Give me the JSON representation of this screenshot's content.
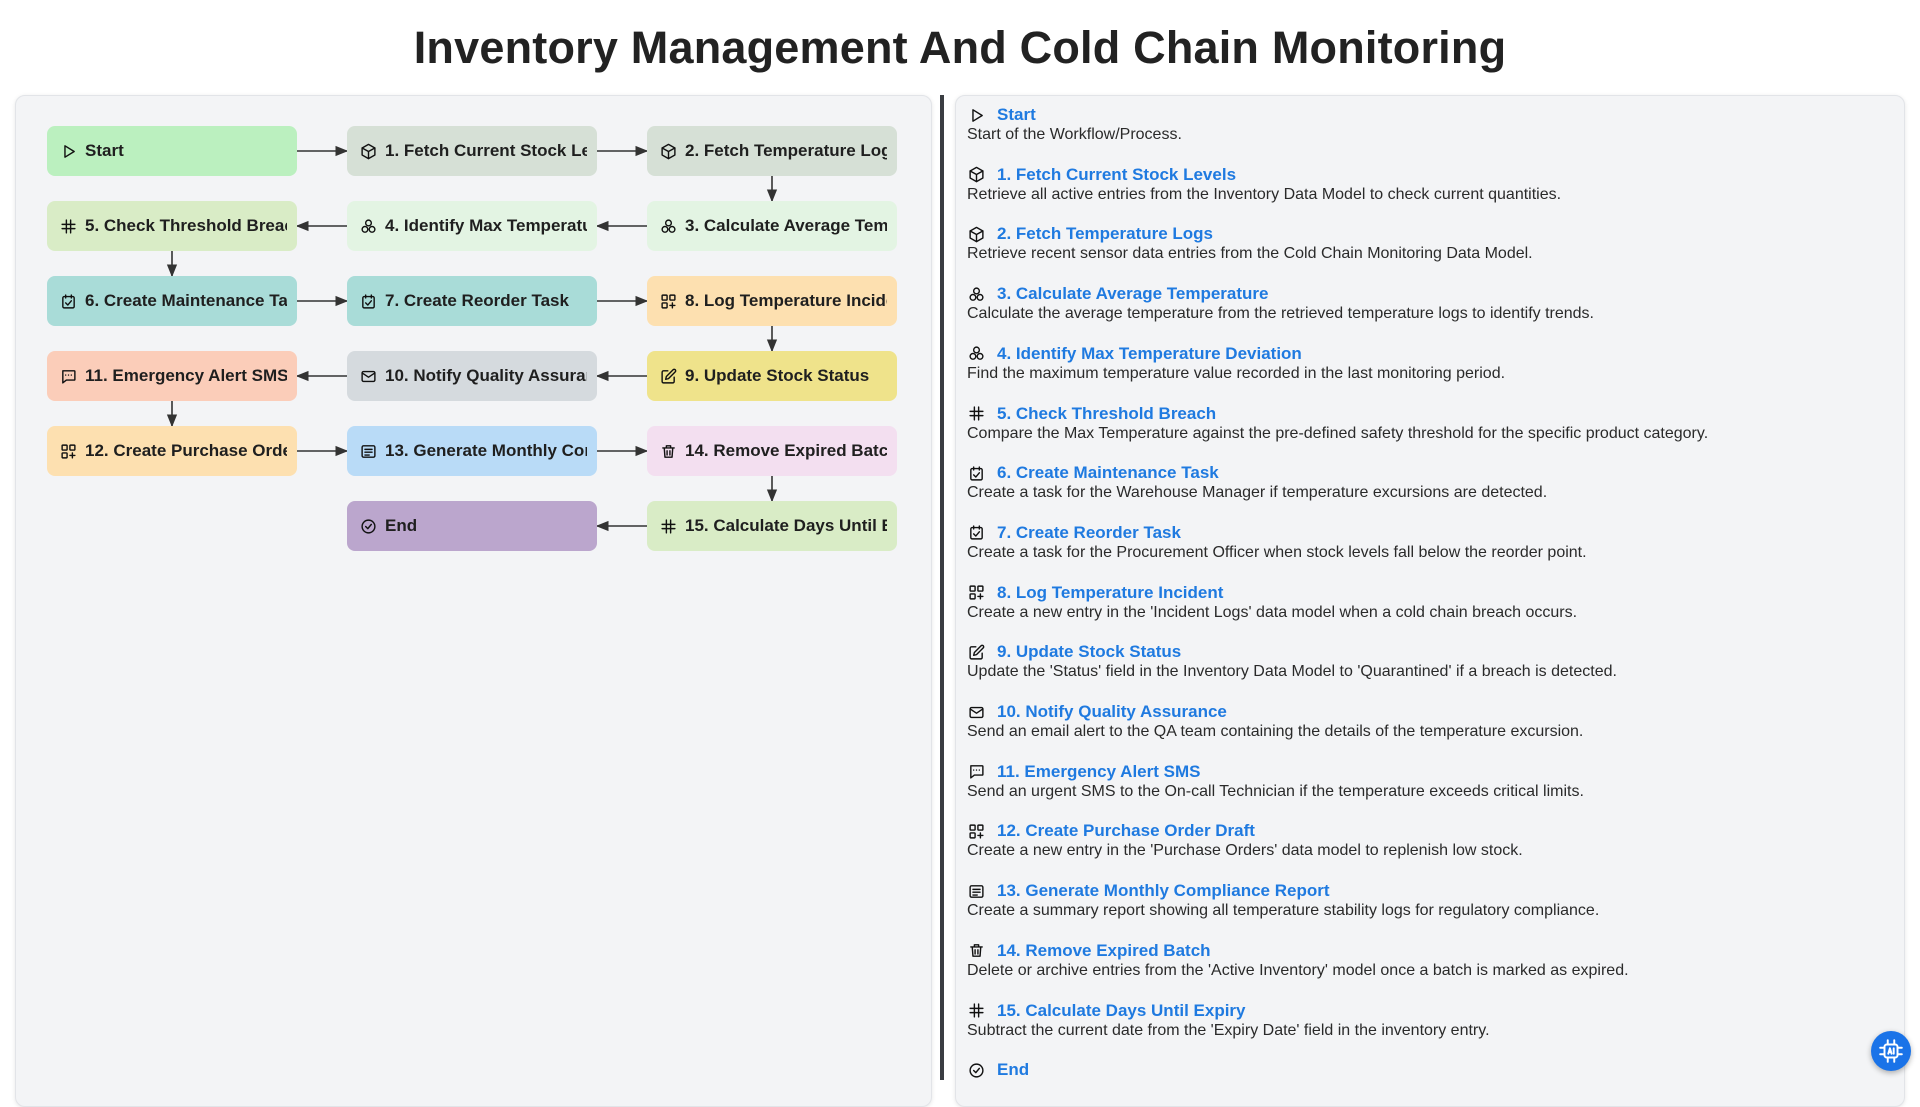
{
  "page": {
    "title": "Inventory Management And Cold Chain Monitoring"
  },
  "colors": {
    "green": "#bbf0bf",
    "sage": "#d6e0d6",
    "mint": "#e3f4e3",
    "lime": "#d9ecc6",
    "teal": "#a9dcd8",
    "peach": "#fde0b0",
    "yellow": "#efe38b",
    "gray": "#d5dade",
    "salmon": "#fbcdb9",
    "blue": "#b9dbf7",
    "pink": "#f3dff0",
    "purple": "#bba6cd",
    "link": "#1f7ae0",
    "fab": "#1a73e8"
  },
  "flow": {
    "nodes": [
      {
        "id": "start",
        "label": "Start",
        "icon": "play-icon",
        "color": "green"
      },
      {
        "id": "s1",
        "label": "1. Fetch Current Stock Levels",
        "icon": "cube-icon",
        "color": "sage"
      },
      {
        "id": "s2",
        "label": "2. Fetch Temperature Logs",
        "icon": "cube-icon",
        "color": "sage"
      },
      {
        "id": "s3",
        "label": "3. Calculate Average Temperature",
        "icon": "function-icon",
        "color": "mint"
      },
      {
        "id": "s4",
        "label": "4. Identify Max Temperature Deviation",
        "icon": "function-icon",
        "color": "mint"
      },
      {
        "id": "s5",
        "label": "5. Check Threshold Breach",
        "icon": "hash-icon",
        "color": "lime"
      },
      {
        "id": "s6",
        "label": "6. Create Maintenance Task",
        "icon": "task-icon",
        "color": "teal"
      },
      {
        "id": "s7",
        "label": "7. Create Reorder Task",
        "icon": "task-icon",
        "color": "teal"
      },
      {
        "id": "s8",
        "label": "8. Log Temperature Incident",
        "icon": "grid-plus-icon",
        "color": "peach"
      },
      {
        "id": "s9",
        "label": "9. Update Stock Status",
        "icon": "edit-icon",
        "color": "yellow"
      },
      {
        "id": "s10",
        "label": "10. Notify Quality Assurance",
        "icon": "mail-icon",
        "color": "gray"
      },
      {
        "id": "s11",
        "label": "11. Emergency Alert SMS",
        "icon": "sms-icon",
        "color": "salmon"
      },
      {
        "id": "s12",
        "label": "12. Create Purchase Order Draft",
        "icon": "grid-plus-icon",
        "color": "peach"
      },
      {
        "id": "s13",
        "label": "13. Generate Monthly Compliance Report",
        "icon": "report-icon",
        "color": "blue"
      },
      {
        "id": "s14",
        "label": "14. Remove Expired Batch",
        "icon": "trash-icon",
        "color": "pink"
      },
      {
        "id": "s15",
        "label": "15. Calculate Days Until Expiry",
        "icon": "hash-icon",
        "color": "lime"
      },
      {
        "id": "end",
        "label": "End",
        "icon": "check-circle-icon",
        "color": "purple"
      }
    ],
    "edges": [
      [
        "start",
        "s1"
      ],
      [
        "s1",
        "s2"
      ],
      [
        "s2",
        "s3"
      ],
      [
        "s3",
        "s4"
      ],
      [
        "s4",
        "s5"
      ],
      [
        "s5",
        "s6"
      ],
      [
        "s6",
        "s7"
      ],
      [
        "s7",
        "s8"
      ],
      [
        "s8",
        "s9"
      ],
      [
        "s9",
        "s10"
      ],
      [
        "s10",
        "s11"
      ],
      [
        "s11",
        "s12"
      ],
      [
        "s12",
        "s13"
      ],
      [
        "s13",
        "s14"
      ],
      [
        "s14",
        "s15"
      ],
      [
        "s15",
        "end"
      ]
    ]
  },
  "details": [
    {
      "title": "Start",
      "icon": "play-icon",
      "desc": "Start of the Workflow/Process."
    },
    {
      "title": "1. Fetch Current Stock Levels",
      "icon": "cube-icon",
      "desc": "Retrieve all active entries from the Inventory Data Model to check current quantities."
    },
    {
      "title": "2. Fetch Temperature Logs",
      "icon": "cube-icon",
      "desc": "Retrieve recent sensor data entries from the Cold Chain Monitoring Data Model."
    },
    {
      "title": "3. Calculate Average Temperature",
      "icon": "function-icon",
      "desc": "Calculate the average temperature from the retrieved temperature logs to identify trends."
    },
    {
      "title": "4. Identify Max Temperature Deviation",
      "icon": "function-icon",
      "desc": "Find the maximum temperature value recorded in the last monitoring period."
    },
    {
      "title": "5. Check Threshold Breach",
      "icon": "hash-icon",
      "desc": "Compare the Max Temperature against the pre-defined safety threshold for the specific product category."
    },
    {
      "title": "6. Create Maintenance Task",
      "icon": "task-icon",
      "desc": "Create a task for the Warehouse Manager if temperature excursions are detected."
    },
    {
      "title": "7. Create Reorder Task",
      "icon": "task-icon",
      "desc": "Create a task for the Procurement Officer when stock levels fall below the reorder point."
    },
    {
      "title": "8. Log Temperature Incident",
      "icon": "grid-plus-icon",
      "desc": "Create a new entry in the 'Incident Logs' data model when a cold chain breach occurs."
    },
    {
      "title": "9. Update Stock Status",
      "icon": "edit-icon",
      "desc": "Update the 'Status' field in the Inventory Data Model to 'Quarantined' if a breach is detected."
    },
    {
      "title": "10. Notify Quality Assurance",
      "icon": "mail-icon",
      "desc": "Send an email alert to the QA team containing the details of the temperature excursion."
    },
    {
      "title": "11. Emergency Alert SMS",
      "icon": "sms-icon",
      "desc": "Send an urgent SMS to the On-call Technician if the temperature exceeds critical limits."
    },
    {
      "title": "12. Create Purchase Order Draft",
      "icon": "grid-plus-icon",
      "desc": "Create a new entry in the 'Purchase Orders' data model to replenish low stock."
    },
    {
      "title": "13. Generate Monthly Compliance Report",
      "icon": "report-icon",
      "desc": "Create a summary report showing all temperature stability logs for regulatory compliance."
    },
    {
      "title": "14. Remove Expired Batch",
      "icon": "trash-icon",
      "desc": "Delete or archive entries from the 'Active Inventory' model once a batch is marked as expired."
    },
    {
      "title": "15. Calculate Days Until Expiry",
      "icon": "hash-icon",
      "desc": "Subtract the current date from the 'Expiry Date' field in the inventory entry."
    },
    {
      "title": "End",
      "icon": "check-circle-icon",
      "desc": ""
    }
  ],
  "help_button": {
    "icon": "ai-chip-icon"
  }
}
